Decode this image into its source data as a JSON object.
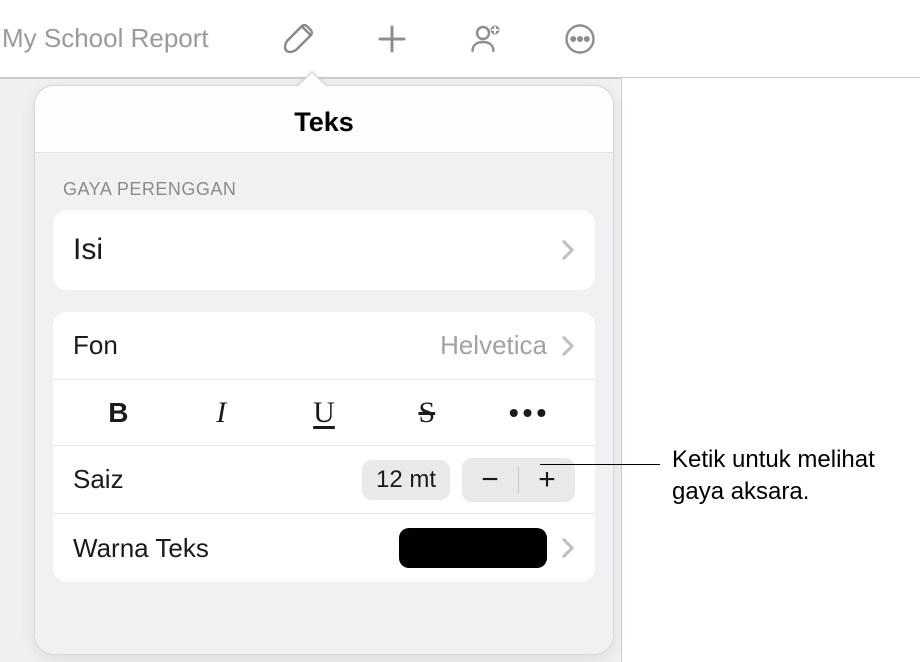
{
  "toolbar": {
    "doc_title": "My School Report"
  },
  "popover": {
    "title": "Teks",
    "paragraph_style_section": "GAYA PERENGGAN",
    "paragraph_style_value": "Isi",
    "font_label": "Fon",
    "font_value": "Helvetica",
    "style_buttons": {
      "bold": "B",
      "italic": "I",
      "underline": "U",
      "strike": "S",
      "more": "•••"
    },
    "size_label": "Saiz",
    "size_value": "12 mt",
    "stepper_minus": "−",
    "stepper_plus": "+",
    "text_color_label": "Warna Teks",
    "text_color_value": "#000000"
  },
  "callout": {
    "text": "Ketik untuk melihat gaya aksara."
  }
}
